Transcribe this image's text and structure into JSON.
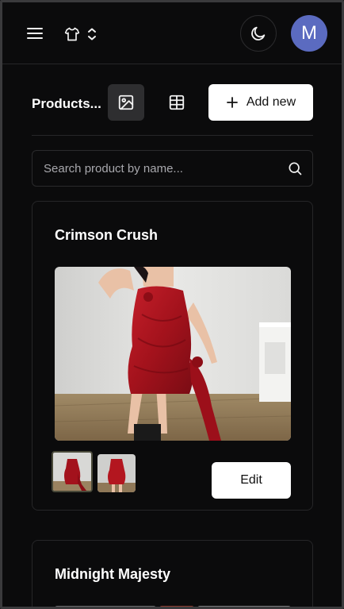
{
  "header": {
    "menu_icon": "hamburger-menu-icon",
    "store_icon": "tshirt-icon",
    "switch_icon": "chevron-up-down-icon",
    "theme_icon": "moon-icon",
    "avatar_initial": "M",
    "avatar_color": "#5b6bc0"
  },
  "toolbar": {
    "title": "Products...",
    "gallery_view_icon": "image-icon",
    "table_view_icon": "table-grid-icon",
    "add_button_label": "Add new",
    "add_icon": "plus-icon"
  },
  "search": {
    "placeholder": "Search product by name...",
    "value": "",
    "icon": "search-icon"
  },
  "products": [
    {
      "name": "Crimson Crush",
      "edit_label": "Edit",
      "thumbnails": 2
    },
    {
      "name": "Midnight Majesty"
    }
  ],
  "colors": {
    "background": "#0b0b0c",
    "border": "#262628",
    "button_light": "#ffffff",
    "dress_red": "#a3121c"
  }
}
